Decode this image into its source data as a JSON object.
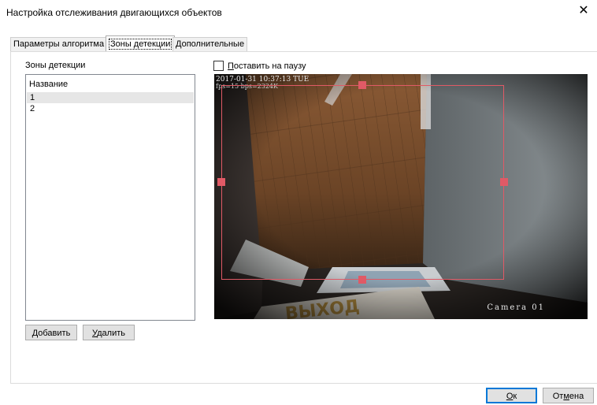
{
  "window": {
    "title": "Настройка отслеживания двигающихся объектов",
    "close_glyph": "✕"
  },
  "tabs": [
    {
      "label": "Параметры алгоритма"
    },
    {
      "label": "Зоны детекции",
      "active": true
    },
    {
      "label": "Дополнительные"
    }
  ],
  "zones": {
    "section_label": "Зоны детекции",
    "list_header": "Название",
    "items": [
      {
        "label": "1",
        "selected": true
      },
      {
        "label": "2",
        "selected": false
      }
    ],
    "add_button": {
      "mnemonic": "Д",
      "rest": "обавить"
    },
    "delete_button": {
      "mnemonic": "У",
      "rest": "далить"
    }
  },
  "pause_checkbox": {
    "mnemonic": "П",
    "rest": "оставить на паузу",
    "checked": false
  },
  "video": {
    "timestamp": "2017-01-31 10:37:13 TUE",
    "fps_text": "fps=15 bps=2324K",
    "camera_label": "Camera 01"
  },
  "footer": {
    "ok_button": {
      "mnemonic": "О",
      "rest": "к"
    },
    "cancel_button": {
      "pre": "От",
      "mnemonic": "м",
      "rest": "ена"
    }
  },
  "colors": {
    "zone_outline": "#e05a66",
    "default_button_border": "#0078d7"
  }
}
